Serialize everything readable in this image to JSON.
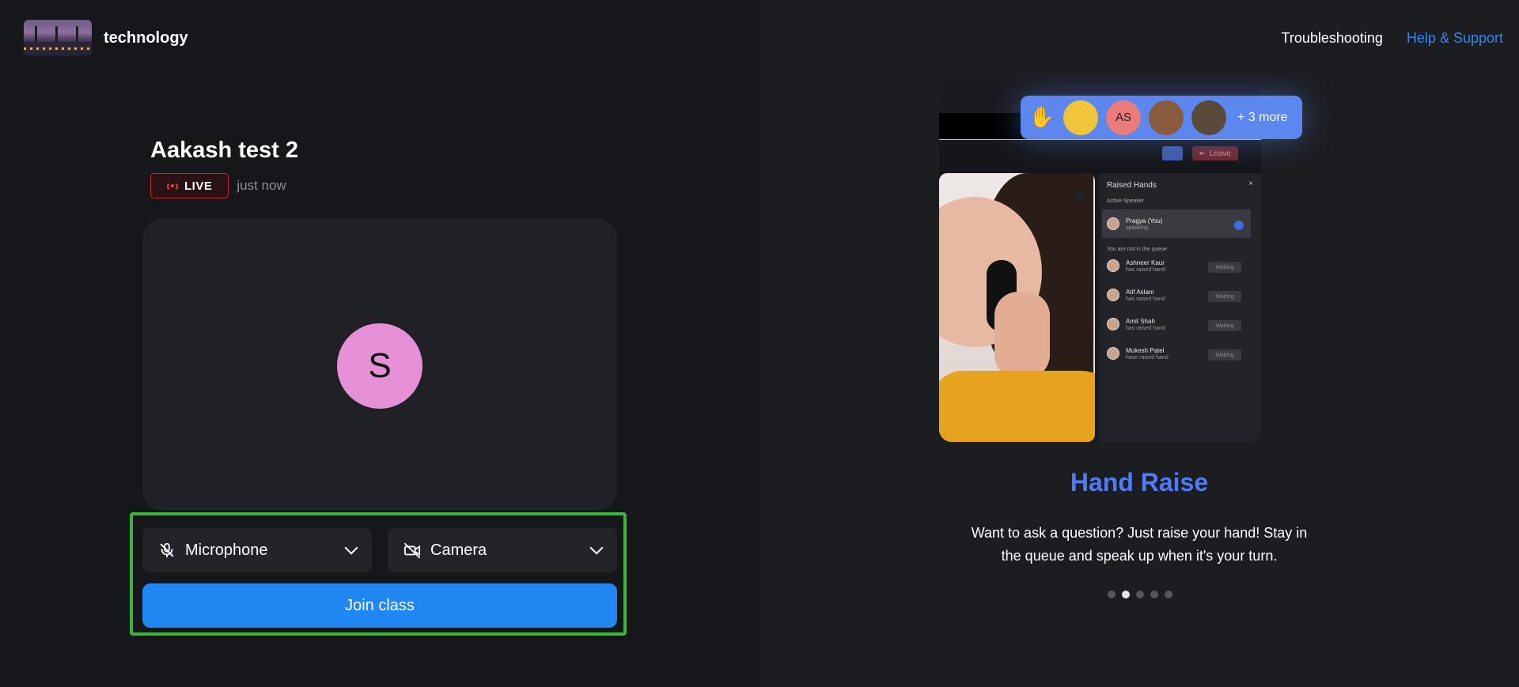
{
  "brand": {
    "name": "technology"
  },
  "nav": {
    "troubleshooting": "Troubleshooting",
    "help": "Help & Support"
  },
  "class_info": {
    "title": "Aakash test 2",
    "live_label": "LIVE",
    "time": "just now"
  },
  "preview": {
    "avatar_initial": "S",
    "avatar_color": "#e690d8"
  },
  "controls": {
    "microphone_label": "Microphone",
    "camera_label": "Camera",
    "join_label": "Join class"
  },
  "feature": {
    "title": "Hand Raise",
    "description": "Want to ask a question? Just raise your hand! Stay in the queue and speak up when it's your turn.",
    "slides_total": 5,
    "active_slide": 2,
    "hand_bar": {
      "initials": "AS",
      "more": "+ 3 more"
    },
    "mock": {
      "leave_label": "Leave",
      "panel_title": "Raised Hands",
      "close": "×",
      "active_speaker_label": "Active Speaker",
      "speaker": {
        "name": "Pragya (You)",
        "status": "speaking"
      },
      "queue_label": "You are not in the queue",
      "queue": [
        {
          "name": "Ashneer Kaur",
          "status": "has raised hand",
          "badge": "Waiting"
        },
        {
          "name": "Atif Aslam",
          "status": "has raised hand",
          "badge": "Waiting"
        },
        {
          "name": "Amit Shah",
          "status": "has raised hand",
          "badge": "Waiting"
        },
        {
          "name": "Mukesh Patel",
          "status": "have raised hand",
          "badge": "Waiting"
        }
      ]
    }
  },
  "colors": {
    "accent": "#1f86f2",
    "live": "#c8262c",
    "highlight": "#3ab63c",
    "feature_title": "#4f7cf5"
  }
}
